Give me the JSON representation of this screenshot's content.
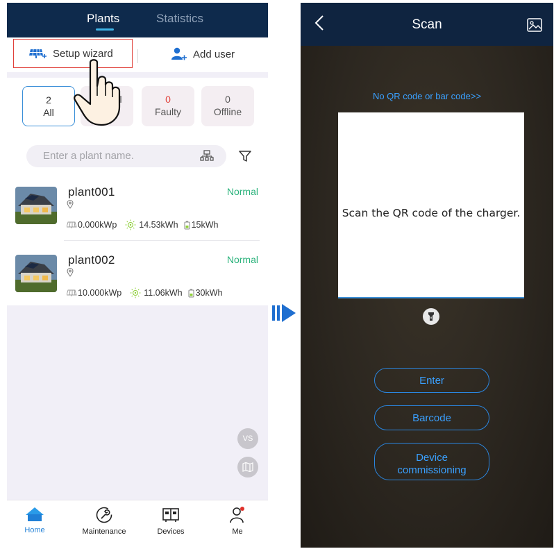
{
  "left": {
    "tabs": [
      {
        "label": "Plants",
        "active": true
      },
      {
        "label": "Statistics",
        "active": false
      }
    ],
    "toolbar": {
      "setup_wizard": "Setup wizard",
      "add_user": "Add user"
    },
    "filters": [
      {
        "count": "2",
        "label": "All",
        "selected": true
      },
      {
        "count": "",
        "label": "l",
        "selected": false
      },
      {
        "count": "0",
        "label": "Faulty",
        "selected": false
      },
      {
        "count": "0",
        "label": "Offline",
        "selected": false
      }
    ],
    "search": {
      "placeholder": "Enter a plant name."
    },
    "plants": [
      {
        "name": "plant001",
        "status": "Normal",
        "capacity": "0.000kWp",
        "yield": "14.53kWh",
        "battery": "15kWh"
      },
      {
        "name": "plant002",
        "status": "Normal",
        "capacity": "10.000kWp",
        "yield": "11.06kWh",
        "battery": "30kWh"
      }
    ],
    "floating": {
      "vs": "VS"
    },
    "nav": [
      {
        "label": "Home",
        "icon": "home-icon",
        "active": true
      },
      {
        "label": "Maintenance",
        "icon": "wrench-icon",
        "active": false
      },
      {
        "label": "Devices",
        "icon": "devices-icon",
        "active": false
      },
      {
        "label": "Me",
        "icon": "person-icon",
        "active": false
      }
    ],
    "colors": {
      "header": "#0e2a4c",
      "accent": "#1f7fd6",
      "normal": "#2ab27b",
      "faulty": "#e0403a"
    }
  },
  "right": {
    "title": "Scan",
    "no_code_link": "No QR code or bar code>>",
    "scan_hint": "Scan the QR code of the charger.",
    "buttons": {
      "enter": "Enter",
      "barcode": "Barcode",
      "device_line1": "Device",
      "device_line2": "commissioning"
    },
    "colors": {
      "header": "#0f2440",
      "link": "#3aa0ff"
    }
  }
}
